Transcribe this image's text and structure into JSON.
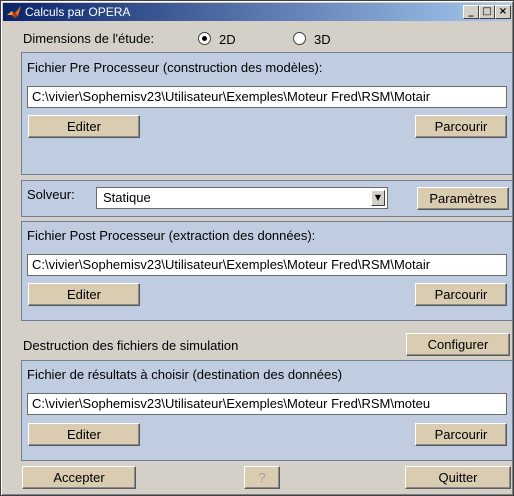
{
  "window": {
    "title": "Calculs par OPERA",
    "controls": {
      "minimize": "_",
      "maximize": "□",
      "close": "×"
    },
    "app_icon": "matlab-logo-icon"
  },
  "dimensions": {
    "label": "Dimensions de l'étude:",
    "options": [
      {
        "label": "2D",
        "selected": true
      },
      {
        "label": "3D",
        "selected": false
      }
    ]
  },
  "preprocessor": {
    "title": "Fichier Pre Processeur (construction des modèles):",
    "path": "C:\\vivier\\Sophemisv23\\Utilisateur\\Exemples\\Moteur Fred\\RSM\\Motair",
    "edit_label": "Editer",
    "browse_label": "Parcourir"
  },
  "solver": {
    "label": "Solveur:",
    "selected": "Statique",
    "params_label": "Paramètres"
  },
  "postprocessor": {
    "title": "Fichier Post Processeur (extraction des données):",
    "path": "C:\\vivier\\Sophemisv23\\Utilisateur\\Exemples\\Moteur Fred\\RSM\\Motair",
    "edit_label": "Editer",
    "browse_label": "Parcourir"
  },
  "destruction": {
    "label": "Destruction des fichiers de simulation",
    "configure_label": "Configurer"
  },
  "results": {
    "title": "Fichier de résultats à choisir (destination des données)",
    "path": "C:\\vivier\\Sophemisv23\\Utilisateur\\Exemples\\Moteur Fred\\RSM\\moteu",
    "edit_label": "Editer",
    "browse_label": "Parcourir"
  },
  "footer": {
    "accept_label": "Accepter",
    "help_label": "?",
    "quit_label": "Quitter"
  },
  "colors": {
    "title_bar_start": "#0a246a",
    "title_bar_end": "#a6caf0",
    "group_panel": "#c0cde0",
    "button_face": "#d9ccb0",
    "window_face": "#d4d0c8"
  }
}
